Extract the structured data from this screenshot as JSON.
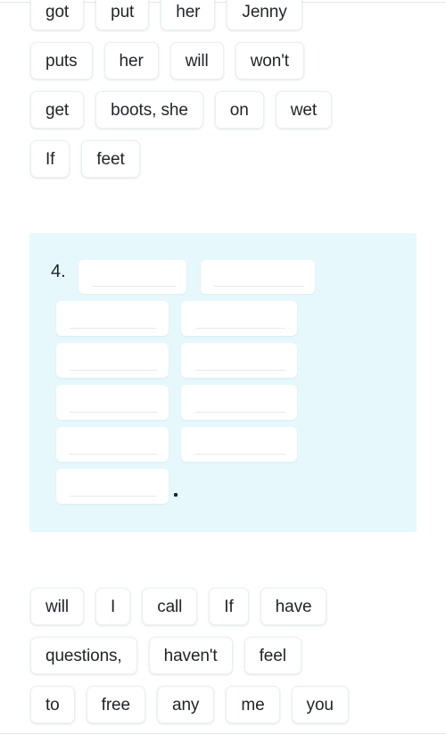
{
  "exercise": {
    "question_number": "4.",
    "sentence_terminator": ".",
    "panel_color": "#e7f8fd",
    "chip_color": "#ffffff",
    "blank_count": 11,
    "blanks": [
      {
        "index": 1,
        "value": "",
        "column": "left"
      },
      {
        "index": 2,
        "value": "",
        "column": "right"
      },
      {
        "index": 3,
        "value": "",
        "column": "left"
      },
      {
        "index": 4,
        "value": "",
        "column": "right"
      },
      {
        "index": 5,
        "value": "",
        "column": "left"
      },
      {
        "index": 6,
        "value": "",
        "column": "right"
      },
      {
        "index": 7,
        "value": "",
        "column": "left"
      },
      {
        "index": 8,
        "value": "",
        "column": "right"
      },
      {
        "index": 9,
        "value": "",
        "column": "left"
      },
      {
        "index": 10,
        "value": "",
        "column": "right"
      },
      {
        "index": 11,
        "value": "",
        "column": "left"
      }
    ]
  },
  "word_bank_top": {
    "rows": [
      [
        {
          "label": "got"
        },
        {
          "label": "put"
        },
        {
          "label": "her"
        },
        {
          "label": "Jenny"
        }
      ],
      [
        {
          "label": "puts"
        },
        {
          "label": "her"
        },
        {
          "label": "will"
        },
        {
          "label": "won't"
        }
      ],
      [
        {
          "label": "get"
        },
        {
          "label": "boots, she"
        },
        {
          "label": "on"
        },
        {
          "label": "wet"
        }
      ],
      [
        {
          "label": "If"
        },
        {
          "label": "feet"
        }
      ]
    ]
  },
  "word_bank_bottom": {
    "rows": [
      [
        {
          "label": "will"
        },
        {
          "label": "I"
        },
        {
          "label": "call"
        },
        {
          "label": "If"
        },
        {
          "label": "have"
        }
      ],
      [
        {
          "label": "questions,"
        },
        {
          "label": "haven't"
        },
        {
          "label": "feel"
        }
      ],
      [
        {
          "label": "to"
        },
        {
          "label": "free"
        },
        {
          "label": "any"
        },
        {
          "label": "me"
        },
        {
          "label": "you"
        }
      ]
    ]
  }
}
